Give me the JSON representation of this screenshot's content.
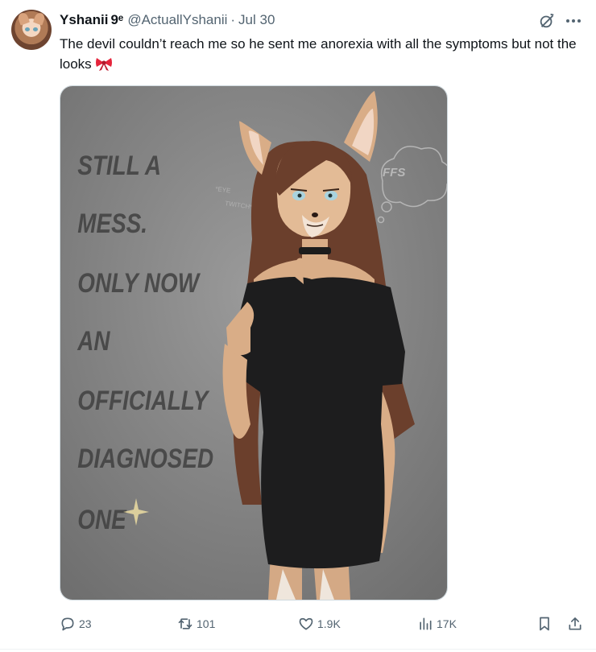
{
  "tweet": {
    "author_name": "Yshanii",
    "pronoun_glyph": "9ᵉ",
    "handle": "@ActuallYshanii",
    "separator": "·",
    "date": "Jul 30",
    "text": "The devil couldn’t reach me so he sent me anorexia with all the symptoms but not the looks",
    "emoji_icon": "ribbon-bow-emoji"
  },
  "media": {
    "lines": [
      "STILL A",
      "MESS.",
      "ONLY NOW",
      "AN",
      "OFFICIALLY",
      "DIAGNOSED",
      "ONE"
    ],
    "thought_bubble": "FFS",
    "side_note": [
      "*EYE",
      "TWITCH*"
    ],
    "colors": {
      "background": "#8b8b8b",
      "dress": "#1d1d1e",
      "fur": "#dcb28c",
      "hair": "#6b3f2c",
      "eye": "#a9d3de"
    }
  },
  "actions": {
    "reply_count": "23",
    "repost_count": "101",
    "like_count": "1.9K",
    "view_count": "17K"
  },
  "icons": [
    "grok-icon",
    "more-icon",
    "reply-icon",
    "repost-icon",
    "like-icon",
    "views-icon",
    "bookmark-icon",
    "share-icon"
  ],
  "accent_color": "#536471"
}
